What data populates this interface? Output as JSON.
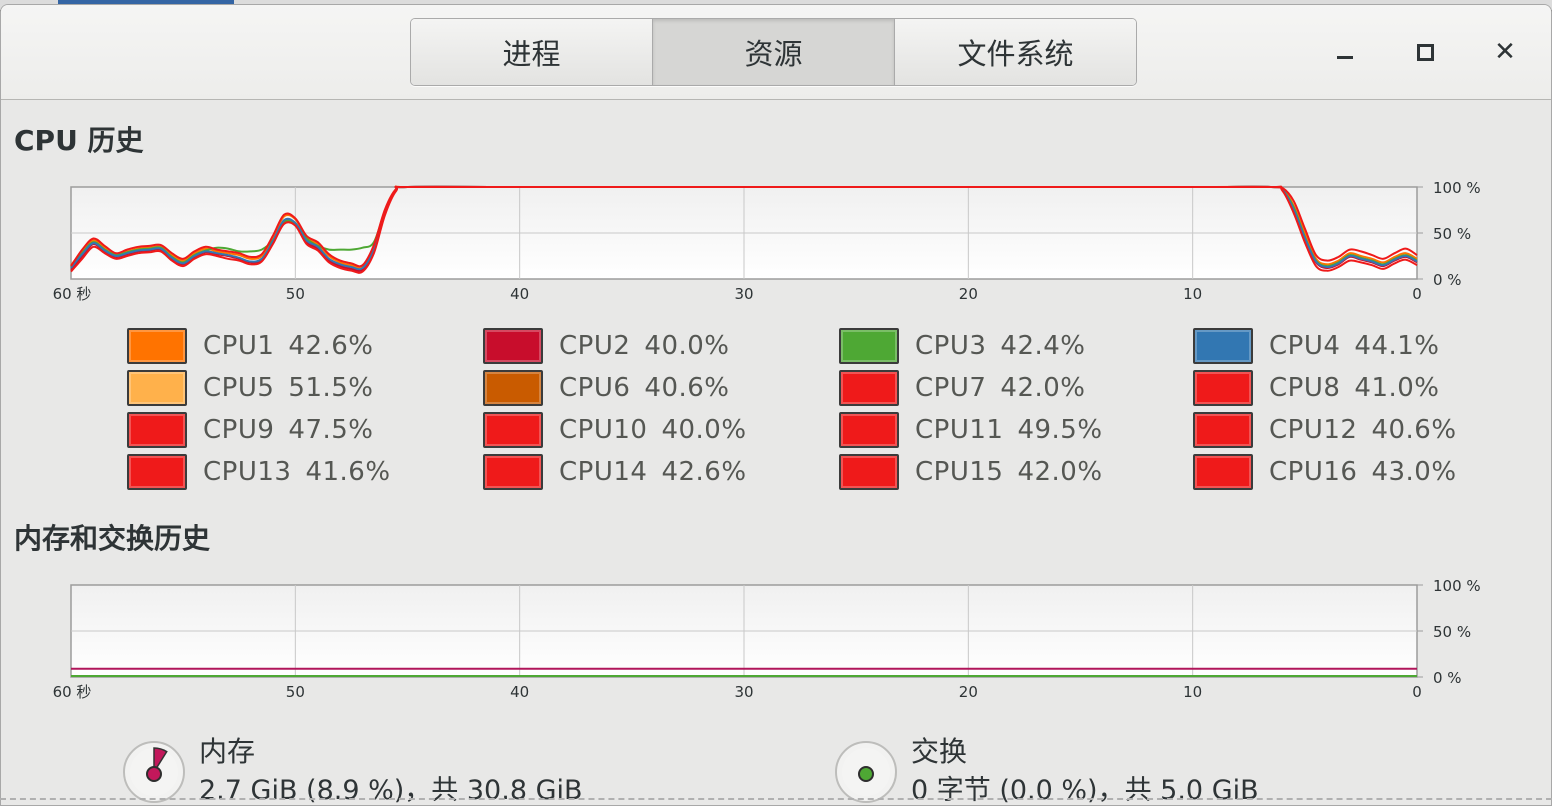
{
  "header": {
    "tabs": [
      {
        "label": "进程",
        "active": false
      },
      {
        "label": "资源",
        "active": true
      },
      {
        "label": "文件系统",
        "active": false
      }
    ],
    "minimize_icon": "minimize-icon",
    "maximize_icon": "maximize-icon",
    "close_icon": "close-icon"
  },
  "cpu": {
    "title": "CPU 历史",
    "legend": [
      {
        "name": "CPU1",
        "value": "42.6%",
        "color": "#ff7300"
      },
      {
        "name": "CPU2",
        "value": "40.0%",
        "color": "#c80d2c"
      },
      {
        "name": "CPU3",
        "value": "42.4%",
        "color": "#4ea834"
      },
      {
        "name": "CPU4",
        "value": "44.1%",
        "color": "#3277b2"
      },
      {
        "name": "CPU5",
        "value": "51.5%",
        "color": "#ffb14b"
      },
      {
        "name": "CPU6",
        "value": "40.6%",
        "color": "#c95b00"
      },
      {
        "name": "CPU7",
        "value": "42.0%",
        "color": "#ef1a1a"
      },
      {
        "name": "CPU8",
        "value": "41.0%",
        "color": "#ef1a1a"
      },
      {
        "name": "CPU9",
        "value": "47.5%",
        "color": "#ef1a1a"
      },
      {
        "name": "CPU10",
        "value": "40.0%",
        "color": "#ef1a1a"
      },
      {
        "name": "CPU11",
        "value": "49.5%",
        "color": "#ef1a1a"
      },
      {
        "name": "CPU12",
        "value": "40.6%",
        "color": "#ef1a1a"
      },
      {
        "name": "CPU13",
        "value": "41.6%",
        "color": "#ef1a1a"
      },
      {
        "name": "CPU14",
        "value": "42.6%",
        "color": "#ef1a1a"
      },
      {
        "name": "CPU15",
        "value": "42.0%",
        "color": "#ef1a1a"
      },
      {
        "name": "CPU16",
        "value": "43.0%",
        "color": "#ef1a1a"
      }
    ]
  },
  "memory": {
    "title": "内存和交换历史",
    "mem_label": "内存",
    "mem_detail": "2.7 GiB (8.9 %)，共 30.8 GiB",
    "mem_fraction": 0.089,
    "mem_color": "#c2185b",
    "swap_label": "交换",
    "swap_detail": "0 字节 (0.0 %)，共 5.0 GiB",
    "swap_fraction": 0.0,
    "swap_color": "#4ea834"
  },
  "chart_data": [
    {
      "type": "line",
      "x_ticks": [
        "60 秒",
        "50",
        "40",
        "30",
        "20",
        "10",
        "0"
      ],
      "y_ticks": [
        "100 %",
        "50 %",
        "0 %"
      ],
      "ylim": [
        0,
        100
      ],
      "xlim": [
        60,
        0
      ],
      "grid": true,
      "series_profile_x": [
        60,
        59.5,
        59,
        58.5,
        58,
        57.5,
        57,
        56.5,
        56,
        55.5,
        55,
        54.5,
        54,
        53.5,
        53,
        52.5,
        52,
        51.5,
        51,
        50.5,
        50,
        49.5,
        49,
        48.5,
        48,
        47.5,
        47,
        46.5,
        46,
        45.5,
        45,
        40,
        30,
        20,
        10,
        6.5,
        6,
        5.5,
        5,
        4.5,
        4,
        3.5,
        3,
        2.5,
        2,
        1.5,
        1,
        0.5,
        0
      ],
      "series": [
        {
          "name": "CPU1",
          "color": "#ff7300",
          "values": [
            15,
            30,
            42,
            34,
            27,
            30,
            33,
            34,
            35,
            26,
            20,
            28,
            33,
            30,
            28,
            26,
            22,
            25,
            45,
            68,
            65,
            45,
            38,
            25,
            18,
            15,
            14,
            35,
            75,
            98,
            100,
            100,
            100,
            100,
            100,
            100,
            98,
            80,
            50,
            22,
            16,
            20,
            28,
            25,
            22,
            18,
            24,
            28,
            22
          ]
        },
        {
          "name": "CPU2",
          "color": "#c80d2c",
          "values": [
            10,
            25,
            38,
            30,
            24,
            27,
            30,
            31,
            32,
            22,
            16,
            24,
            29,
            27,
            25,
            22,
            18,
            21,
            40,
            63,
            60,
            40,
            33,
            20,
            14,
            11,
            10,
            30,
            72,
            97,
            100,
            100,
            100,
            100,
            100,
            100,
            97,
            75,
            44,
            18,
            12,
            16,
            24,
            21,
            18,
            14,
            20,
            24,
            18
          ]
        },
        {
          "name": "CPU3",
          "color": "#4ea834",
          "values": [
            13,
            28,
            40,
            32,
            26,
            29,
            32,
            33,
            34,
            24,
            18,
            26,
            31,
            34,
            33,
            30,
            30,
            32,
            42,
            62,
            60,
            44,
            36,
            32,
            32,
            32,
            34,
            40,
            74,
            97,
            100,
            100,
            100,
            100,
            100,
            100,
            97,
            78,
            46,
            20,
            14,
            18,
            26,
            23,
            20,
            16,
            22,
            26,
            20
          ]
        },
        {
          "name": "CPU4",
          "color": "#3277b2",
          "values": [
            12,
            27,
            39,
            31,
            25,
            28,
            31,
            32,
            33,
            23,
            17,
            25,
            30,
            28,
            26,
            23,
            19,
            22,
            41,
            64,
            61,
            42,
            35,
            22,
            16,
            13,
            12,
            32,
            73,
            97,
            100,
            100,
            100,
            100,
            100,
            100,
            97,
            76,
            45,
            19,
            13,
            17,
            25,
            22,
            19,
            15,
            21,
            25,
            19
          ]
        },
        {
          "name": "CPU7",
          "color": "#ef1a1a",
          "values": [
            14,
            32,
            44,
            36,
            28,
            32,
            35,
            36,
            37,
            28,
            22,
            30,
            35,
            32,
            30,
            28,
            24,
            27,
            47,
            70,
            66,
            47,
            40,
            27,
            20,
            17,
            15,
            37,
            76,
            98,
            100,
            100,
            100,
            100,
            100,
            100,
            99,
            85,
            55,
            26,
            20,
            24,
            32,
            30,
            26,
            22,
            28,
            33,
            26
          ]
        },
        {
          "name": "CPU11",
          "color": "#ef1a1a",
          "values": [
            8,
            22,
            35,
            28,
            22,
            25,
            28,
            29,
            30,
            20,
            14,
            22,
            27,
            25,
            22,
            20,
            16,
            19,
            38,
            60,
            58,
            38,
            31,
            18,
            12,
            9,
            8,
            28,
            70,
            96,
            100,
            100,
            100,
            100,
            100,
            100,
            96,
            72,
            40,
            14,
            9,
            13,
            20,
            18,
            15,
            11,
            17,
            21,
            15
          ]
        }
      ]
    },
    {
      "type": "line",
      "x_ticks": [
        "60 秒",
        "50",
        "40",
        "30",
        "20",
        "10",
        "0"
      ],
      "y_ticks": [
        "100 %",
        "50 %",
        "0 %"
      ],
      "ylim": [
        0,
        100
      ],
      "xlim": [
        60,
        0
      ],
      "grid": true,
      "series": [
        {
          "name": "内存",
          "color": "#b0155a",
          "values": [
            8.9,
            8.9
          ]
        },
        {
          "name": "交换",
          "color": "#4ea834",
          "values": [
            0,
            0
          ]
        }
      ]
    }
  ]
}
